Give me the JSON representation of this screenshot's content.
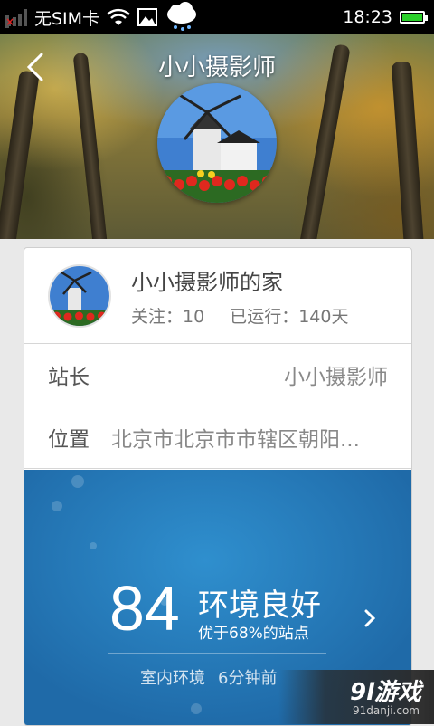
{
  "status_bar": {
    "carrier": "无SIM卡",
    "time": "18:23",
    "icons": [
      "signal-icon",
      "wifi-icon",
      "image-notification-icon",
      "weather-icon",
      "battery-icon"
    ]
  },
  "header": {
    "title": "小小摄影师"
  },
  "profile": {
    "home_name": "小小摄影师的家",
    "follow": "关注：10",
    "running": "已运行：140天"
  },
  "rows": {
    "owner_label": "站长",
    "owner_value": "小小摄影师",
    "location_label": "位置",
    "location_value": "北京市北京市市辖区朝阳..."
  },
  "environment": {
    "score": "84",
    "status": "环境良好",
    "comparison": "优于68%的站点",
    "footer_label": "室内环境",
    "footer_time": "6分钟前"
  },
  "watermark": {
    "main": "9l游戏",
    "sub": "91danji.com"
  },
  "colors": {
    "battery": "#2bd12b",
    "panel": "#2f8fce",
    "title": "#ffffff"
  }
}
